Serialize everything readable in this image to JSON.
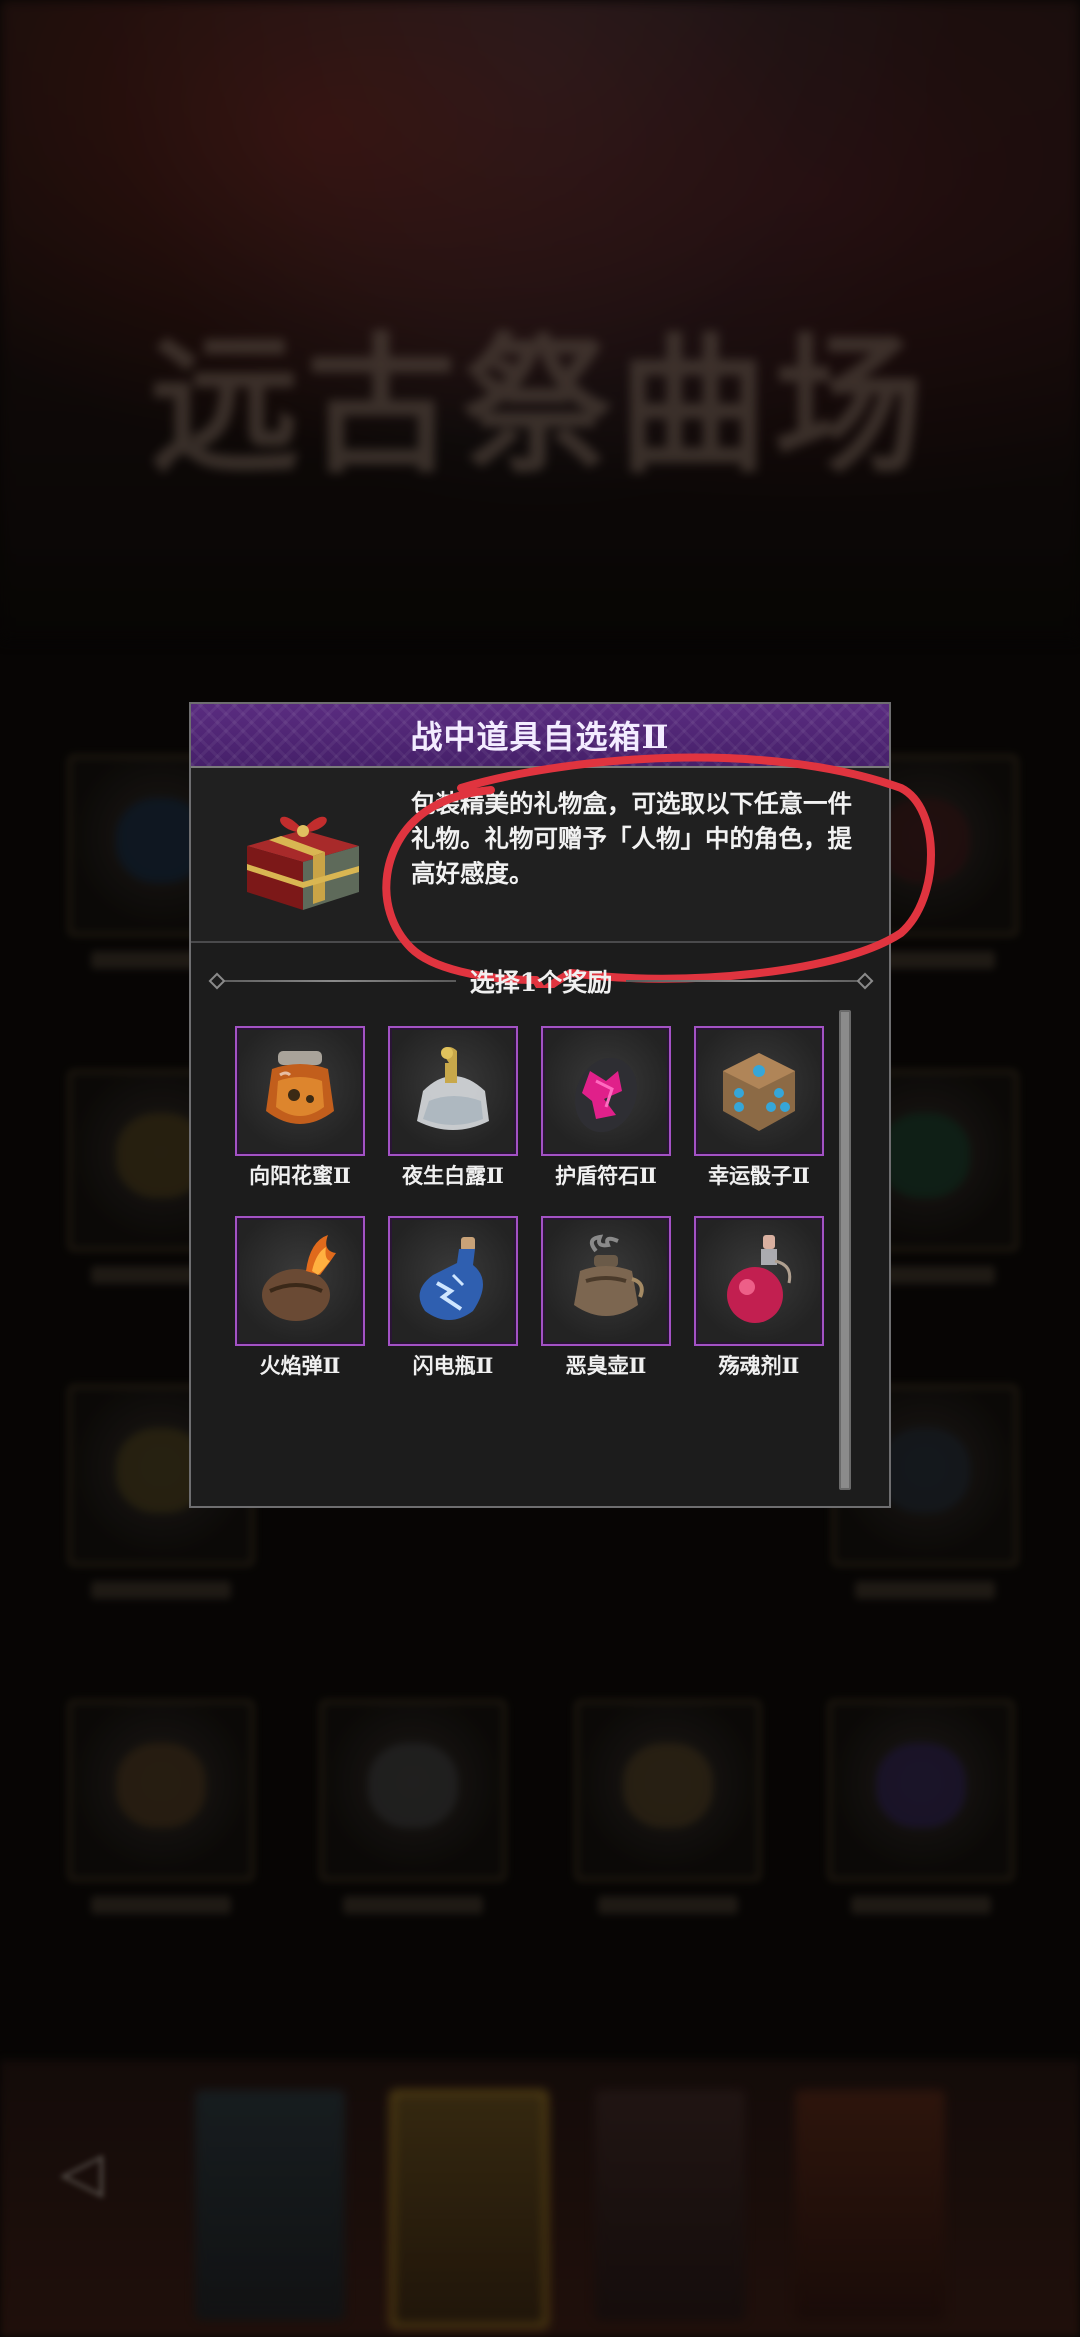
{
  "background": {
    "title": "远古祭曲场"
  },
  "dialog": {
    "title": "战中道具自选箱Ⅱ",
    "description": "包装精美的礼物盒，可选取以下任意一件礼物。礼物可赠予「人物」中的角色，提高好感度。",
    "section_label": "选择1个奖励",
    "items": [
      {
        "name": "向阳花蜜Ⅱ",
        "icon": "honey-jar-icon"
      },
      {
        "name": "夜生白露Ⅱ",
        "icon": "dew-flask-icon"
      },
      {
        "name": "护盾符石Ⅱ",
        "icon": "shield-rune-stone-icon"
      },
      {
        "name": "幸运骰子Ⅱ",
        "icon": "lucky-dice-icon"
      },
      {
        "name": "火焰弹Ⅱ",
        "icon": "fire-bomb-icon"
      },
      {
        "name": "闪电瓶Ⅱ",
        "icon": "lightning-bottle-icon"
      },
      {
        "name": "恶臭壶Ⅱ",
        "icon": "stench-pot-icon"
      },
      {
        "name": "殇魂剂Ⅱ",
        "icon": "soul-potion-icon"
      }
    ]
  },
  "colors": {
    "header": "#4e2472",
    "item_border": "#a352c5",
    "annotation": "#e0343f"
  }
}
